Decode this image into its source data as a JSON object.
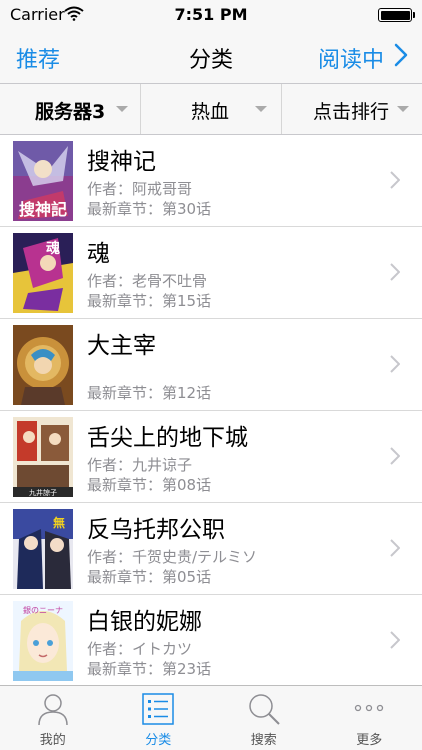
{
  "status": {
    "carrier": "Carrier",
    "time": "7:51 PM"
  },
  "nav": {
    "left": "推荐",
    "title": "分类",
    "right": "阅读中"
  },
  "filters": [
    {
      "label": "服务器3"
    },
    {
      "label": "热血"
    },
    {
      "label": "点击排行"
    }
  ],
  "list": [
    {
      "title": "搜神记",
      "author": "作者：阿戒哥哥",
      "chapter": "最新章节：第30话",
      "cover_text": "搜神記"
    },
    {
      "title": "魂",
      "author": "作者：老骨不吐骨",
      "chapter": "最新章节：第15话",
      "cover_text": "魂"
    },
    {
      "title": "大主宰",
      "author": "",
      "chapter": "最新章节：第12话",
      "cover_text": ""
    },
    {
      "title": "舌尖上的地下城",
      "author": "作者：九井谅子",
      "chapter": "最新章节：第08话",
      "cover_text": "九井諒子"
    },
    {
      "title": "反乌托邦公职",
      "author": "作者：千贺史贵/テルミソ",
      "chapter": "最新章节：第05话",
      "cover_text": "無"
    },
    {
      "title": "白银的妮娜",
      "author": "作者：イトカツ",
      "chapter": "最新章节：第23话",
      "cover_text": "銀のニーナ"
    }
  ],
  "tabs": [
    {
      "label": "我的",
      "icon": "person-icon"
    },
    {
      "label": "分类",
      "icon": "list-icon"
    },
    {
      "label": "搜索",
      "icon": "search-icon"
    },
    {
      "label": "更多",
      "icon": "more-icon"
    }
  ],
  "colors": {
    "accent": "#1a8ce6",
    "secondary_text": "#8e8e93"
  }
}
